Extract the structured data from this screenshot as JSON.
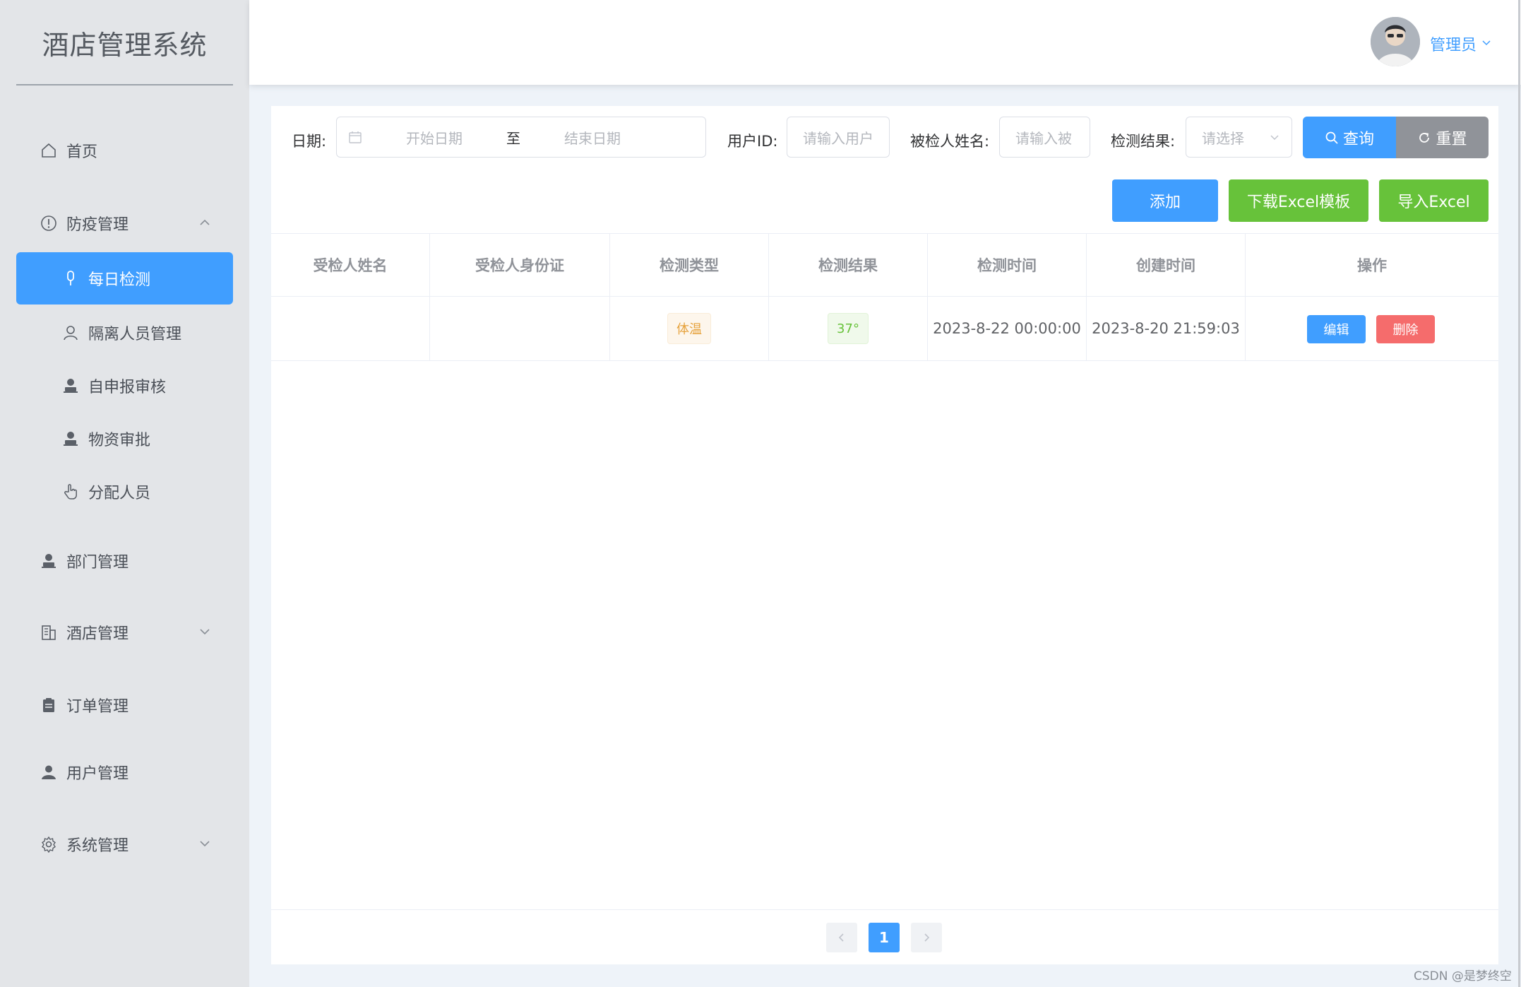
{
  "app": {
    "title": "酒店管理系统"
  },
  "sidebar": {
    "items": [
      {
        "label": "首页",
        "icon": "home-icon"
      },
      {
        "label": "防疫管理",
        "icon": "alert-circle-icon",
        "expanded": true
      },
      {
        "label": "每日检测",
        "icon": "thermometer-icon",
        "active": true
      },
      {
        "label": "隔离人员管理",
        "icon": "user-icon"
      },
      {
        "label": "自申报审核",
        "icon": "user-stamp-icon"
      },
      {
        "label": "物资审批",
        "icon": "user-stamp-icon"
      },
      {
        "label": "分配人员",
        "icon": "hand-pointer-icon"
      },
      {
        "label": "部门管理",
        "icon": "user-stamp-icon"
      },
      {
        "label": "酒店管理",
        "icon": "building-icon"
      },
      {
        "label": "订单管理",
        "icon": "clipboard-icon"
      },
      {
        "label": "用户管理",
        "icon": "user-filled-icon"
      },
      {
        "label": "系统管理",
        "icon": "gear-icon"
      }
    ]
  },
  "header": {
    "user": "管理员"
  },
  "filters": {
    "date_label": "日期:",
    "start_placeholder": "开始日期",
    "range_sep": "至",
    "end_placeholder": "结束日期",
    "userid_label": "用户ID:",
    "userid_placeholder": "请输入用户",
    "name_label": "被检人姓名:",
    "name_placeholder": "请输入被",
    "result_label": "检测结果:",
    "result_placeholder": "请选择",
    "search_label": "查询",
    "reset_label": "重置"
  },
  "actions": {
    "add": "添加",
    "download_template": "下载Excel模板",
    "import_excel": "导入Excel"
  },
  "table": {
    "columns": [
      "受检人姓名",
      "受检人身份证",
      "检测类型",
      "检测结果",
      "检测时间",
      "创建时间",
      "操作"
    ],
    "rows": [
      {
        "name": "",
        "id_card": "",
        "type": "体温",
        "result": "37°",
        "test_time": "2023-8-22 00:00:00",
        "created": "2023-8-20 21:59:03",
        "edit": "编辑",
        "delete": "删除"
      }
    ]
  },
  "pagination": {
    "current": "1"
  },
  "watermark": "CSDN @是梦终空",
  "colors": {
    "primary": "#409eff",
    "success": "#67c23a",
    "danger": "#f56c6c",
    "info": "#909399"
  }
}
